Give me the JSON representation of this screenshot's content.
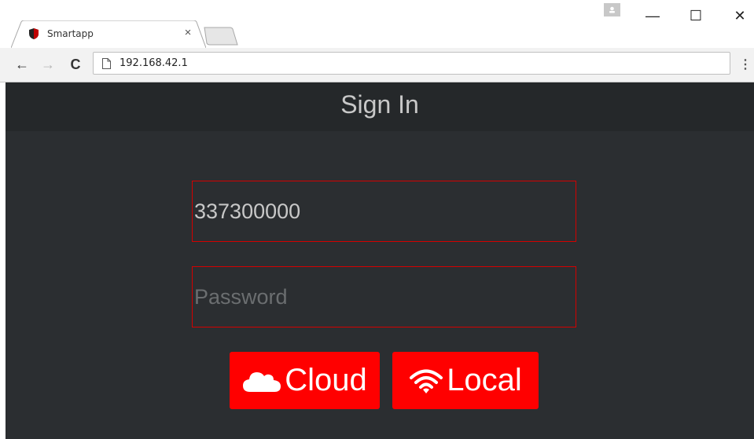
{
  "browser": {
    "tab_title": "Smartapp",
    "tab_close": "×",
    "url": "192.168.42.1",
    "window_controls": {
      "minimize": "—",
      "maximize": "☐",
      "close": "✕"
    },
    "nav": {
      "back": "←",
      "forward": "→",
      "reload": "C",
      "menu": "⋮"
    },
    "icons": [
      "shield-favicon",
      "profile-icon",
      "page-icon"
    ]
  },
  "page": {
    "title": "Sign In",
    "username_value": "337300000",
    "password_placeholder": "Password",
    "buttons": {
      "cloud": "Cloud",
      "local": "Local"
    },
    "colors": {
      "background": "#2b2e31",
      "header": "#25282a",
      "accent": "#ff0000",
      "field_border": "#d40000"
    }
  }
}
